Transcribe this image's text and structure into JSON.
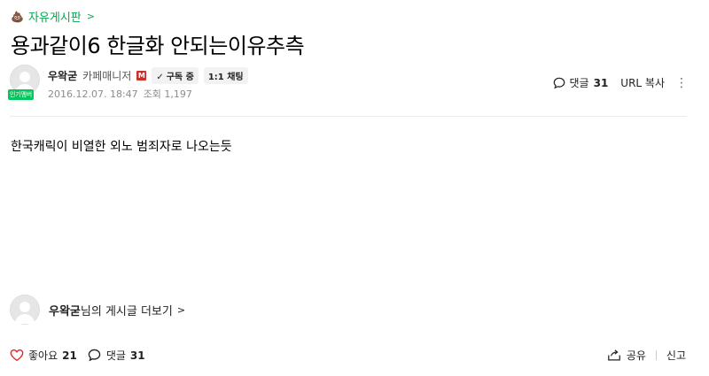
{
  "board": {
    "icon": "poop-icon",
    "name": "자유게시판",
    "chevron": ">"
  },
  "post": {
    "title": "용과같이6 한글화 안되는이유추측",
    "author": {
      "name": "우왁굳",
      "role": "카페매니저",
      "manager_badge": "M",
      "subscribe_label": "구독 중",
      "chat_label": "1:1 채팅",
      "popular_badge": "인기멤버"
    },
    "date": "2016.12.07. 18:47",
    "views_label": "조회 1,197",
    "body": "한국캐릭이 비열한 외노 범죄자로 나오는듯"
  },
  "top_actions": {
    "comment_label": "댓글",
    "comment_count": "31",
    "url_copy_label": "URL 복사",
    "more_dots": "⋮"
  },
  "more_posts": {
    "name": "우왁굳",
    "suffix": "님의 게시글 더보기",
    "chevron": ">"
  },
  "bottom": {
    "like_label": "좋아요",
    "like_count": "21",
    "comment_label": "댓글",
    "comment_count": "31",
    "share_label": "공유",
    "report_label": "신고"
  },
  "colors": {
    "accent": "#03a94d",
    "popular": "#03c75a",
    "manager": "#c9302c",
    "heart": "#e02020"
  }
}
